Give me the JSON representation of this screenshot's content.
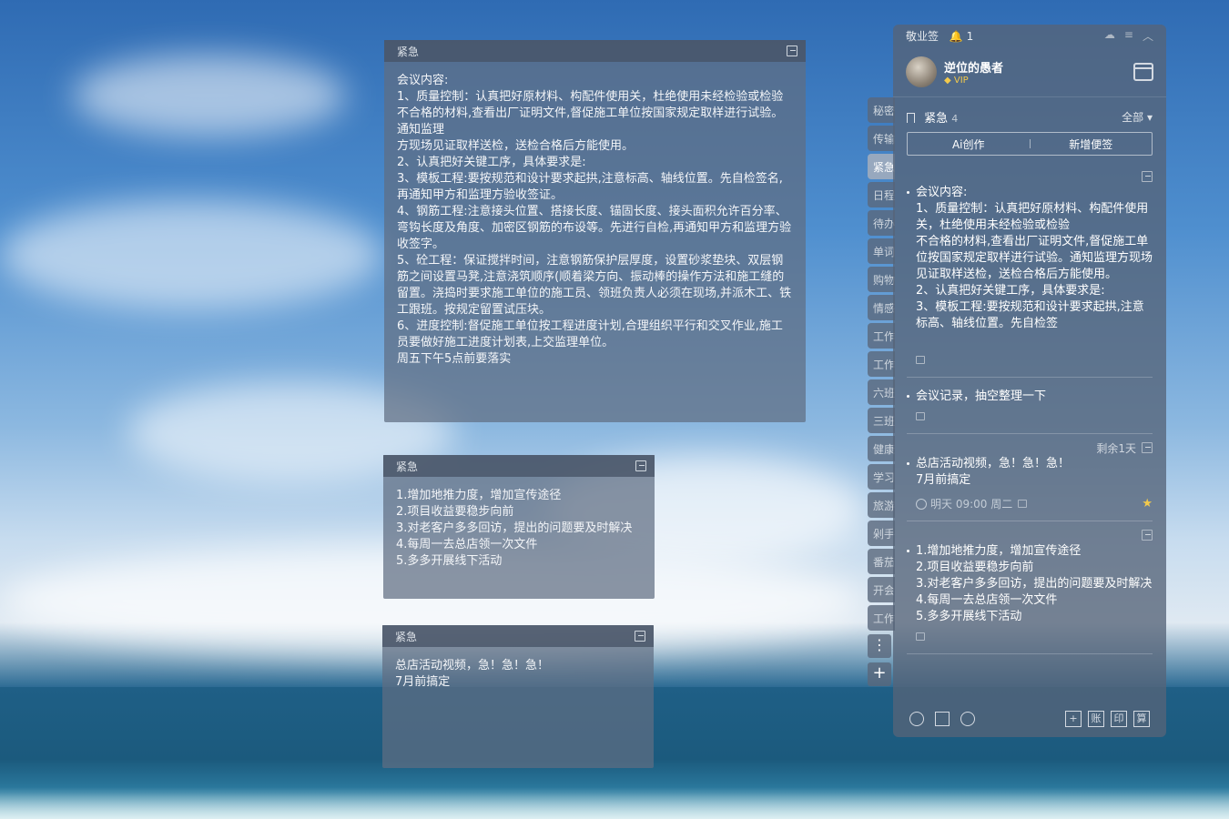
{
  "note1": {
    "category": "紧急",
    "text": "会议内容:\n1、质量控制：认真把好原材料、构配件使用关，杜绝使用未经检验或检验不合格的材料,查看出厂证明文件,督促施工单位按国家规定取样进行试验。通知监理\n方现场见证取样送检，送检合格后方能使用。\n2、认真把好关键工序，具体要求是:\n3、模板工程:要按规范和设计要求起拱,注意标高、轴线位置。先自检签名,再通知甲方和监理方验收签证。\n4、钢筋工程:注意接头位置、搭接长度、锚固长度、接头面积允许百分率、弯钩长度及角度、加密区钢筋的布设等。先进行自检,再通知甲方和监理方验收签字。\n5、砼工程：保证搅拌时间，注意钢筋保护层厚度，设置砂浆垫块、双层钢筋之间设置马凳,注意浇筑顺序(顺着梁方向、振动棒的操作方法和施工缝的留置。浇捣时要求施工单位的施工员、领班负责人必须在现场,并派木工、铁工跟班。按规定留置试压块。\n6、进度控制:督促施工单位按工程进度计划,合理组织平行和交叉作业,施工员要做好施工进度计划表,上交监理单位。\n周五下午5点前要落实"
  },
  "note2": {
    "category": "紧急",
    "text": "1.增加地推力度，增加宣传途径\n2.项目收益要稳步向前\n3.对老客户多多回访，提出的问题要及时解决\n4.每周一去总店领一次文件\n5.多多开展线下活动"
  },
  "note3": {
    "category": "紧急",
    "text": "总店活动视频，急！急！急！\n7月前搞定"
  },
  "tabs": [
    "秘密",
    "传输",
    "紧急",
    "日程",
    "待办",
    "单词",
    "购物",
    "情感",
    "工作",
    "工作",
    "六班",
    "三班",
    "健康",
    "学习",
    "旅游",
    "剁手",
    "番茄",
    "开会",
    "工作"
  ],
  "panel": {
    "app_title": "敬业签",
    "bell_count": "1",
    "username": "逆位的愚者",
    "vip": "VIP",
    "category": "紧急",
    "category_count": "4",
    "filter": "全部",
    "ai_label": "Ai创作",
    "new_label": "新增便签",
    "items": [
      {
        "tag": "",
        "text": "会议内容:\n1、质量控制：认真把好原材料、构配件使用关，杜绝使用未经检验或检验\n不合格的材料,查看出厂证明文件,督促施工单位按国家规定取样进行试验。通知监理方现场见证取样送检，送检合格后方能使用。\n2、认真把好关键工序，具体要求是:\n3、模板工程:要按规范和设计要求起拱,注意标高、轴线位置。先自检签"
      },
      {
        "tag": "",
        "text": "会议记录，抽空整理一下"
      },
      {
        "tag": "剩余1天",
        "text": "总店活动视频，急！急！急！\n7月前搞定",
        "time": "明天 09:00 周二"
      },
      {
        "tag": "",
        "text": "1.增加地推力度，增加宣传途径\n2.项目收益要稳步向前\n3.对老客户多多回访，提出的问题要及时解决\n4.每周一去总店领一次文件\n5.多多开展线下活动"
      }
    ],
    "bottom_buttons": [
      "+",
      "账",
      "印",
      "算"
    ]
  }
}
